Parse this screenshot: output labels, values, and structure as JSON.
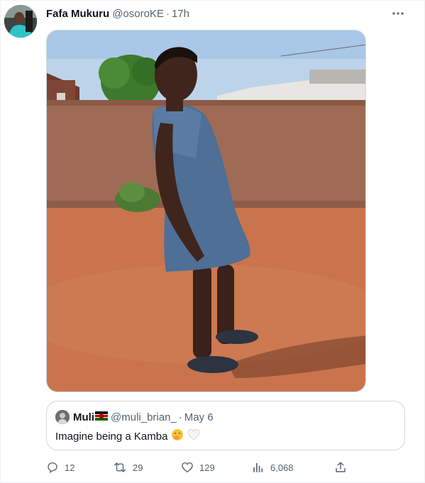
{
  "tweet": {
    "display_name": "Fafa Mukuru",
    "handle": "@osoroKE",
    "separator": "·",
    "time": "17h",
    "avatar_icon": "profile-avatar",
    "more_icon": "more-horizontal-icon"
  },
  "media": {
    "image_icon": "photo-person-denim-dress"
  },
  "quote": {
    "display_name": "Muli",
    "flag_icon": "kenya-flag-icon",
    "handle": "@muli_brian_",
    "separator": "·",
    "date": "May 6",
    "text": "Imagine being a Kamba",
    "emojis": [
      "face-with-hand-over-mouth-emoji",
      "white-heart-emoji"
    ]
  },
  "actions": {
    "reply": {
      "icon": "reply-icon",
      "count": "12"
    },
    "retweet": {
      "icon": "retweet-icon",
      "count": "29"
    },
    "like": {
      "icon": "heart-icon",
      "count": "129"
    },
    "views": {
      "icon": "analytics-icon",
      "count": "6,068"
    },
    "share": {
      "icon": "share-icon"
    }
  },
  "colors": {
    "text_primary": "#0f1419",
    "text_secondary": "#536471",
    "border": "#cfd9de"
  }
}
